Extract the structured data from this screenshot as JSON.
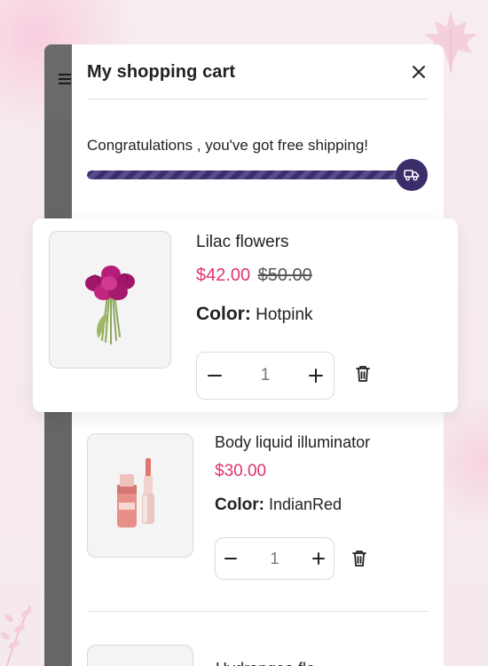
{
  "cart": {
    "title": "My shopping cart",
    "shipping_message": "Congratulations , you've got free shipping!",
    "shipping_progress_percent": 100,
    "items": [
      {
        "name": "Lilac flowers",
        "sale_price": "$42.00",
        "original_price": "$50.00",
        "color_label": "Color:",
        "color_value": "Hotpink",
        "quantity": "1"
      },
      {
        "name": "Body liquid illuminator",
        "sale_price": "$30.00",
        "color_label": "Color:",
        "color_value": "IndianRed",
        "quantity": "1"
      },
      {
        "name": "Hydrangea flo"
      }
    ]
  },
  "icons": {
    "menu": "menu-icon",
    "close": "close-icon",
    "shipping": "truck-icon",
    "minus": "minus-icon",
    "plus": "plus-icon",
    "delete": "trash-icon"
  },
  "colors": {
    "accent": "#3a2d6a",
    "sale_price": "#e0356f",
    "background": "#f6eaed"
  }
}
